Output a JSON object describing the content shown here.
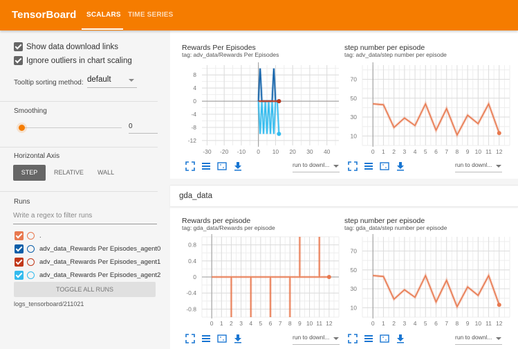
{
  "header": {
    "brand": "TensorBoard",
    "tabs": [
      {
        "label": "SCALARS",
        "active": true
      },
      {
        "label": "TIME SERIES",
        "active": false
      }
    ],
    "color": "#f57c00"
  },
  "sidebar": {
    "show_download_links": {
      "label": "Show data download links",
      "checked": true
    },
    "ignore_outliers": {
      "label": "Ignore outliers in chart scaling",
      "checked": true
    },
    "tooltip_sorting": {
      "label": "Tooltip sorting method:",
      "value": "default"
    },
    "smoothing": {
      "label": "Smoothing",
      "value": "0",
      "fraction": 0
    },
    "horizontal_axis": {
      "label": "Horizontal Axis",
      "options": [
        "STEP",
        "RELATIVE",
        "WALL"
      ],
      "selected": "STEP"
    },
    "runs": {
      "label": "Runs",
      "filter_placeholder": "Write a regex to filter runs",
      "items": [
        {
          "name": ".",
          "color": "#e8794f",
          "checked": true
        },
        {
          "name": "adv_data_Rewards Per Episodes_agent0",
          "color": "#0b5ea8",
          "checked": true
        },
        {
          "name": "adv_data_Rewards Per Episodes_agent1",
          "color": "#c1381a",
          "checked": true
        },
        {
          "name": "adv_data_Rewards Per Episodes_agent2",
          "color": "#33bbee",
          "checked": true
        }
      ],
      "toggle_all_label": "TOGGLE ALL RUNS",
      "log_dir": "logs_tensorboard/211021"
    }
  },
  "main": {
    "group_name": "gda_data",
    "run_dropdown_label": "run to downl...",
    "icons": [
      "fullscreen-icon",
      "data-table-icon",
      "fit-domain-icon",
      "download-icon"
    ]
  },
  "chart_data": [
    {
      "id": "adv_rewards",
      "type": "line",
      "title": "Rewards Per Episodes",
      "tag": "tag: adv_data/Rewards Per Episodes",
      "xlim": [
        -33,
        47
      ],
      "ylim": [
        -13.5,
        11
      ],
      "xticks": [
        -30,
        -20,
        -10,
        0,
        10,
        20,
        30,
        40
      ],
      "yticks": [
        8,
        4,
        0,
        -4,
        -8,
        -12
      ],
      "series": [
        {
          "name": "adv_data_Rewards Per Episodes_agent0",
          "color": "#0b5ea8",
          "x": [
            0,
            1,
            2,
            3,
            4,
            5,
            6,
            7,
            8,
            9,
            10,
            11,
            12
          ],
          "y": [
            0,
            10,
            0,
            0,
            0,
            0,
            0,
            0,
            0,
            10,
            0,
            0,
            0
          ]
        },
        {
          "name": "adv_data_Rewards Per Episodes_agent2",
          "color": "#33bbee",
          "x": [
            0,
            1,
            2,
            3,
            4,
            5,
            6,
            7,
            8,
            9,
            10,
            11,
            12
          ],
          "y": [
            0,
            -10,
            0,
            -10,
            0,
            -10,
            0,
            -10,
            0,
            -10,
            0,
            0,
            -10
          ]
        },
        {
          "name": "adv_data_Rewards Per Episodes_agent1",
          "color": "#c1381a",
          "x": [
            0,
            1,
            2,
            3,
            4,
            5,
            6,
            7,
            8,
            9,
            10,
            11,
            12
          ],
          "y": [
            0,
            0,
            0,
            0,
            0,
            0,
            0,
            0,
            0,
            0,
            0,
            0,
            0
          ]
        }
      ]
    },
    {
      "id": "adv_steps",
      "type": "line",
      "title": "step number per episode",
      "tag": "tag: adv_data/step number per episode",
      "xlim": [
        -1,
        13
      ],
      "ylim": [
        0,
        85
      ],
      "xticks": [
        0,
        1,
        2,
        3,
        4,
        5,
        6,
        7,
        8,
        9,
        10,
        11,
        12
      ],
      "yticks": [
        70,
        50,
        30,
        10
      ],
      "series": [
        {
          "name": ".",
          "color": "#e8794f",
          "x": [
            0,
            1,
            2,
            3,
            4,
            5,
            6,
            7,
            8,
            9,
            10,
            11,
            12
          ],
          "y": [
            44,
            43,
            19,
            29,
            21,
            44,
            16,
            39,
            11,
            32,
            23,
            44,
            13
          ]
        }
      ]
    },
    {
      "id": "gda_rewards",
      "type": "line",
      "title": "Rewards per episode",
      "tag": "tag: gda_data/Rewards per episode",
      "xlim": [
        -1,
        13
      ],
      "ylim": [
        -1,
        1
      ],
      "xticks": [
        0,
        1,
        2,
        3,
        4,
        5,
        6,
        7,
        8,
        9,
        10,
        11,
        12
      ],
      "yticks": [
        0.8,
        0.4,
        0,
        -0.4,
        -0.8
      ],
      "series": [
        {
          "name": ".",
          "color": "#e8794f",
          "x": [
            0,
            1,
            2,
            2,
            2,
            3,
            4,
            4,
            4,
            5,
            6,
            6,
            6,
            7,
            8,
            8,
            8,
            9,
            9,
            9,
            10,
            11,
            11,
            11,
            12
          ],
          "y": [
            0,
            0,
            0,
            -1,
            0,
            0,
            0,
            -1,
            0,
            0,
            0,
            -1,
            0,
            0,
            0,
            -1,
            0,
            0,
            1,
            0,
            0,
            0,
            1,
            0,
            0
          ]
        }
      ]
    },
    {
      "id": "gda_steps",
      "type": "line",
      "title": "step number per episode",
      "tag": "tag: gda_data/step number per episode",
      "xlim": [
        -1,
        13
      ],
      "ylim": [
        0,
        85
      ],
      "xticks": [
        0,
        1,
        2,
        3,
        4,
        5,
        6,
        7,
        8,
        9,
        10,
        11,
        12
      ],
      "yticks": [
        70,
        50,
        30,
        10
      ],
      "series": [
        {
          "name": ".",
          "color": "#e8794f",
          "x": [
            0,
            1,
            2,
            3,
            4,
            5,
            6,
            7,
            8,
            9,
            10,
            11,
            12
          ],
          "y": [
            44,
            43,
            19,
            29,
            21,
            44,
            16,
            39,
            11,
            32,
            23,
            44,
            13
          ]
        }
      ]
    }
  ]
}
